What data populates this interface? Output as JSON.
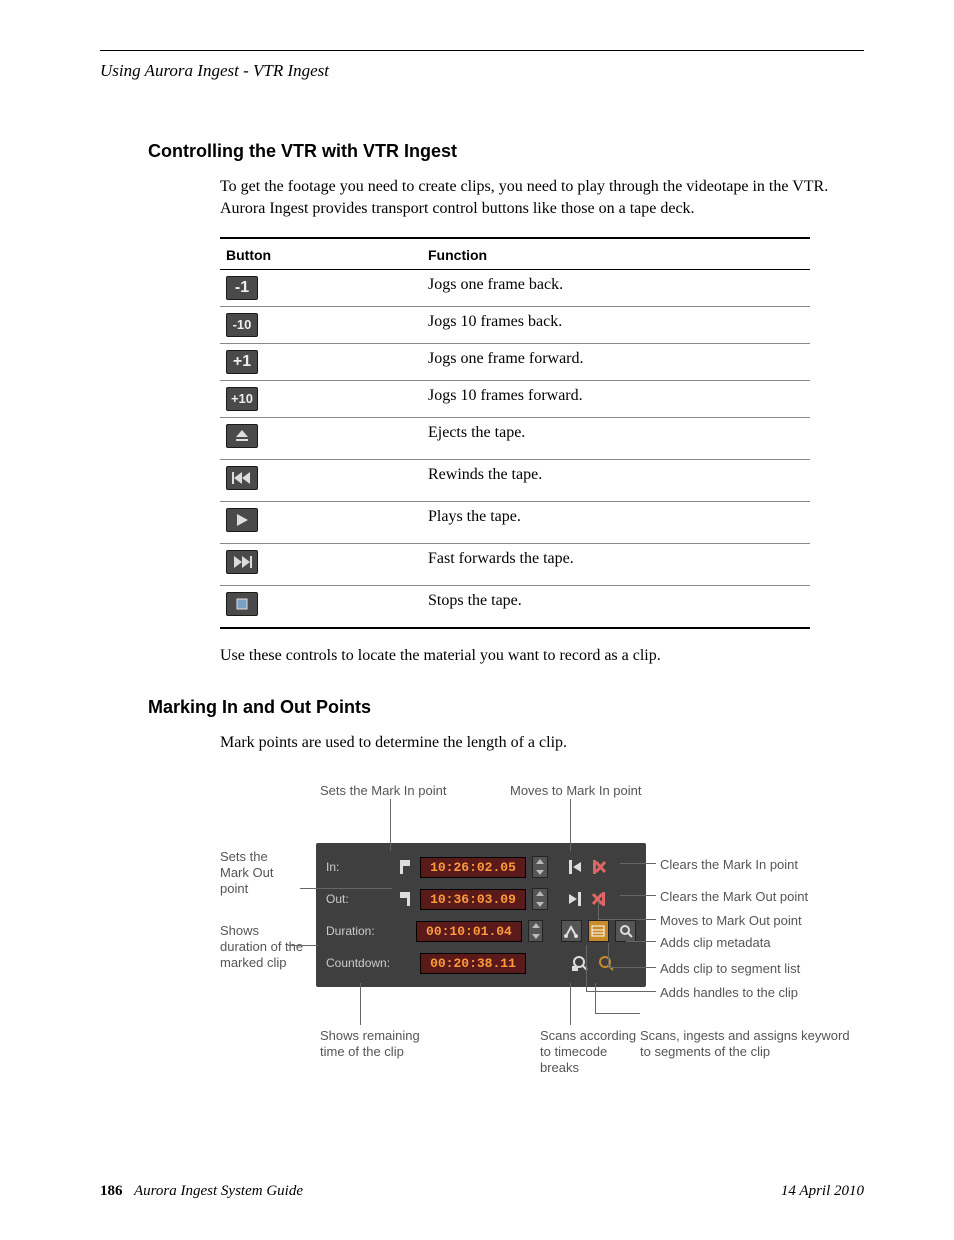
{
  "running_head": "Using Aurora Ingest - VTR Ingest",
  "section1": {
    "title": "Controlling the VTR with VTR Ingest",
    "intro": "To get the footage you need to create clips, you need to play through the videotape in the VTR. Aurora Ingest provides transport control buttons like those on a tape deck.",
    "th_button": "Button",
    "th_function": "Function",
    "rows": [
      {
        "btn": "-1",
        "fn": "Jogs one frame back."
      },
      {
        "btn": "-10",
        "fn": "Jogs 10 frames back."
      },
      {
        "btn": "+1",
        "fn": "Jogs one frame forward."
      },
      {
        "btn": "+10",
        "fn": "Jogs 10 frames forward."
      },
      {
        "btn": "eject",
        "fn": "Ejects the tape."
      },
      {
        "btn": "rew",
        "fn": "Rewinds the tape."
      },
      {
        "btn": "play",
        "fn": "Plays the tape."
      },
      {
        "btn": "ff",
        "fn": "Fast forwards the tape."
      },
      {
        "btn": "stop",
        "fn": "Stops the tape."
      }
    ],
    "outro": "Use these controls to locate the material you want to record as a clip."
  },
  "section2": {
    "title": "Marking In and Out Points",
    "intro": "Mark points are used to determine the length of a clip."
  },
  "diagram": {
    "panel": {
      "in_label": "In:",
      "out_label": "Out:",
      "dur_label": "Duration:",
      "cd_label": "Countdown:",
      "in_tc": "10:26:02.05",
      "out_tc": "10:36:03.09",
      "dur_tc": "00:10:01.04",
      "cd_tc": "00:20:38.11"
    },
    "callouts": {
      "top_left": "Sets the Mark In point",
      "top_right": "Moves to Mark In point",
      "left_markout": "Sets the Mark Out point",
      "left_duration": "Shows duration of the marked clip",
      "bot_left": "Shows remaining time of the clip",
      "bot_mid": "Scans according to timecode breaks",
      "bot_right": "Scans, ingests and assigns keyword to segments of the clip",
      "r_clear_in": "Clears the Mark In point",
      "r_clear_out": "Clears the Mark Out point",
      "r_move_out": "Moves to Mark Out point",
      "r_metadata": "Adds clip metadata",
      "r_seglist": "Adds clip to segment list",
      "r_handles": "Adds handles to the clip"
    }
  },
  "footer": {
    "page": "186",
    "title": "Aurora Ingest System Guide",
    "date": "14 April 2010"
  }
}
